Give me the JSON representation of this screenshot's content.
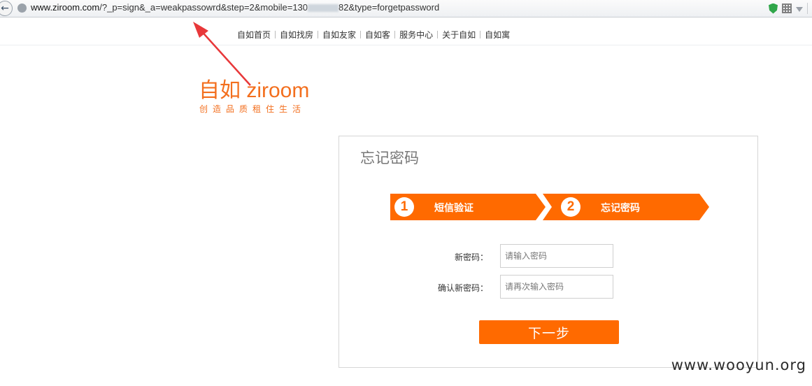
{
  "browser": {
    "url_prefix": "www.ziroom.com",
    "url_path_before": "/?_p=sign&_a=weakpassowrd&step=2&mobile=130",
    "url_path_after": "82&type=forgetpassword"
  },
  "topnav": {
    "items": [
      "自如首页",
      "自如找房",
      "自如友家",
      "自如客",
      "服务中心",
      "关于自如",
      "自如寓"
    ]
  },
  "logo": {
    "main": "自如 ziroom",
    "tagline": "创造品质租住生活"
  },
  "form": {
    "title": "忘记密码",
    "steps": [
      {
        "number": "1",
        "label": "短信验证"
      },
      {
        "number": "2",
        "label": "忘记密码"
      }
    ],
    "new_password": {
      "label": "新密码：",
      "placeholder": "请输入密码"
    },
    "confirm_password": {
      "label": "确认新密码：",
      "placeholder": "请再次输入密码"
    },
    "next_label": "下一步"
  },
  "watermark": "www.wooyun.org",
  "colors": {
    "brand_orange": "#ff6a00",
    "logo_orange": "#f36f1e",
    "annotation_red": "#e8383a"
  }
}
